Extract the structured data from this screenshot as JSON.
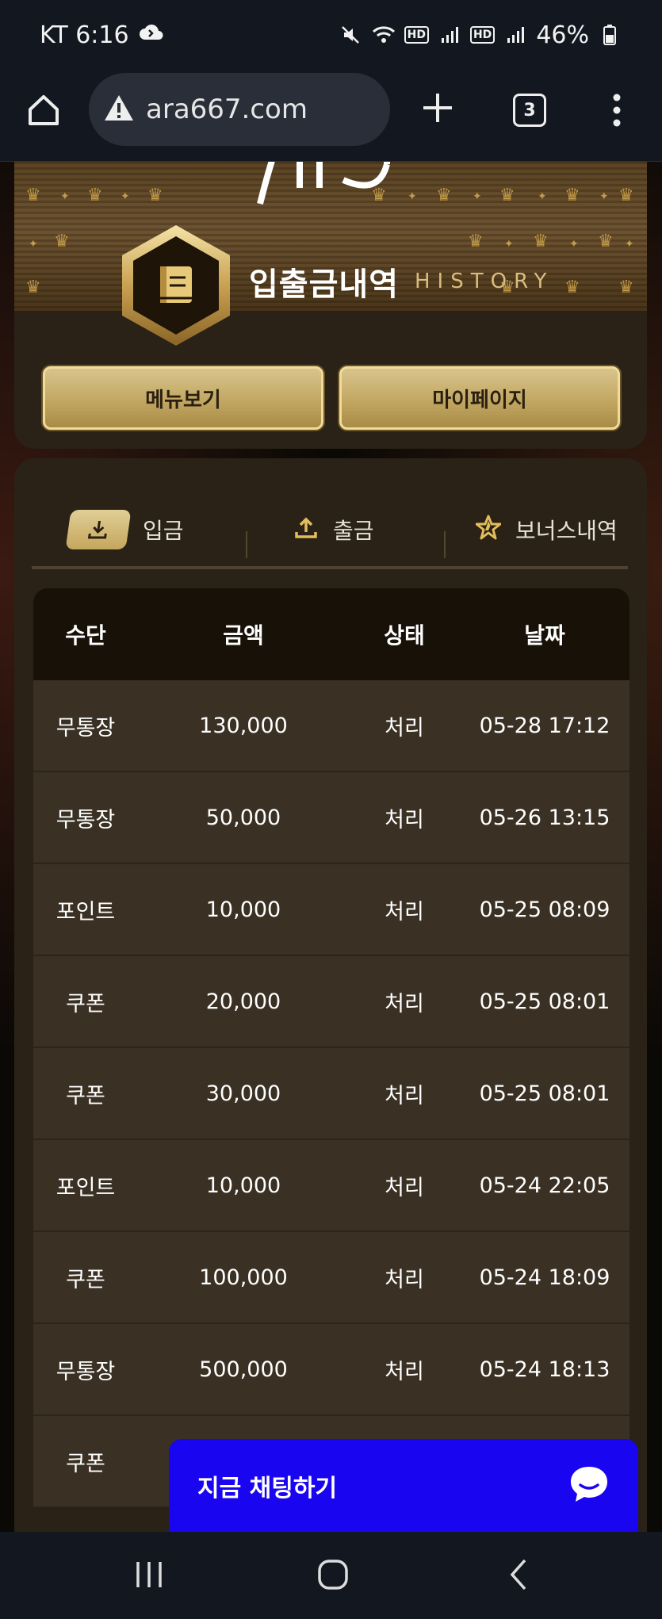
{
  "status_bar": {
    "carrier_time": "KT 6:16",
    "hd1": "HD",
    "hd2": "HD",
    "battery": "46%"
  },
  "browser": {
    "url": "ara667.com",
    "tab_count": "3"
  },
  "header": {
    "title": "입출금내역",
    "subtitle": "HISTORY",
    "menu_button": "메뉴보기",
    "mypage_button": "마이페이지"
  },
  "tabs": [
    {
      "label": "입금",
      "icon": "download-icon",
      "active": true
    },
    {
      "label": "출금",
      "icon": "upload-icon",
      "active": false
    },
    {
      "label": "보너스내역",
      "icon": "star-icon",
      "active": false
    }
  ],
  "table": {
    "headers": [
      "수단",
      "금액",
      "상태",
      "날짜"
    ],
    "rows": [
      {
        "method": "무통장",
        "amount": "130,000",
        "status": "처리",
        "date": "05-28 17:12"
      },
      {
        "method": "무통장",
        "amount": "50,000",
        "status": "처리",
        "date": "05-26 13:15"
      },
      {
        "method": "포인트",
        "amount": "10,000",
        "status": "처리",
        "date": "05-25 08:09"
      },
      {
        "method": "쿠폰",
        "amount": "20,000",
        "status": "처리",
        "date": "05-25 08:01"
      },
      {
        "method": "쿠폰",
        "amount": "30,000",
        "status": "처리",
        "date": "05-25 08:01"
      },
      {
        "method": "포인트",
        "amount": "10,000",
        "status": "처리",
        "date": "05-24 22:05"
      },
      {
        "method": "쿠폰",
        "amount": "100,000",
        "status": "처리",
        "date": "05-24 18:09"
      },
      {
        "method": "무통장",
        "amount": "500,000",
        "status": "처리",
        "date": "05-24 18:13"
      },
      {
        "method": "쿠폰",
        "amount": "",
        "status": "",
        "date": ""
      }
    ]
  },
  "chat": {
    "label": "지금 채팅하기"
  },
  "colors": {
    "gold": "#c9a862",
    "card_bg": "#2a2216",
    "row_bg": "#3a3124",
    "chat_blue": "#1a05f0"
  }
}
